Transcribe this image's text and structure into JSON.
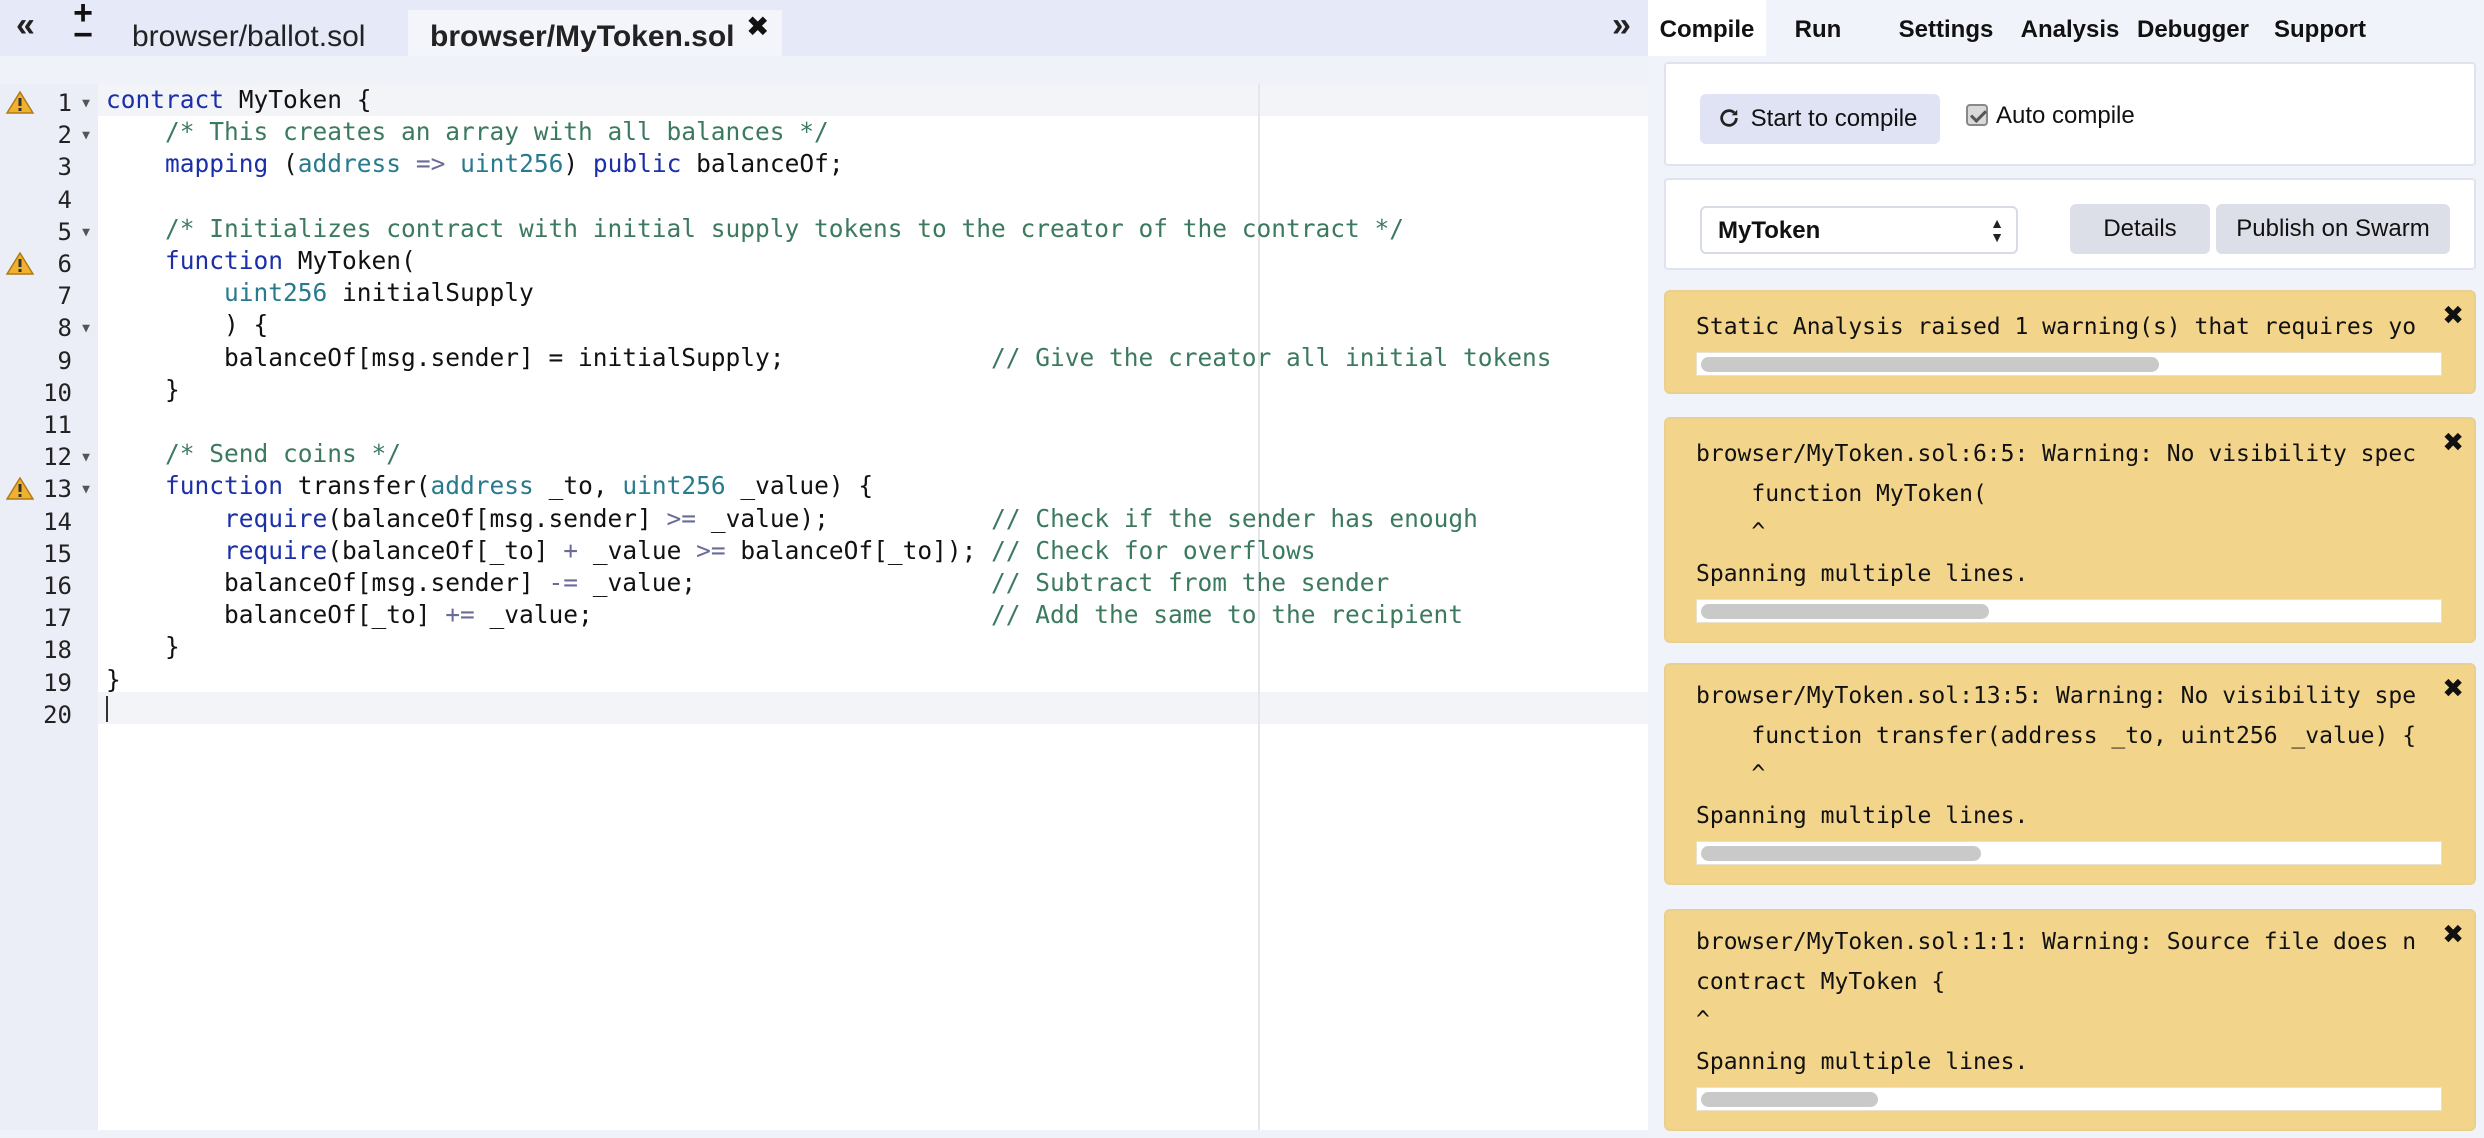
{
  "tabs": {
    "left_arrow": "«",
    "right_arrow": "»",
    "plus": "+",
    "minus": "−",
    "files": [
      "browser/ballot.sol",
      "browser/MyToken.sol"
    ],
    "close": "✖"
  },
  "editor": {
    "line_numbers": [
      "1",
      "2",
      "3",
      "4",
      "5",
      "6",
      "7",
      "8",
      "9",
      "10",
      "11",
      "12",
      "13",
      "14",
      "15",
      "16",
      "17",
      "18",
      "19",
      "20"
    ],
    "warning_lines": [
      1,
      6,
      13
    ],
    "fold_lines": [
      1,
      2,
      5,
      8,
      12,
      13
    ],
    "code": [
      "contract MyToken {",
      "    /* This creates an array with all balances */",
      "    mapping (address => uint256) public balanceOf;",
      "",
      "    /* Initializes contract with initial supply tokens to the creator of the contract */",
      "    function MyToken(",
      "        uint256 initialSupply",
      "        ) {",
      "        balanceOf[msg.sender] = initialSupply;              // Give the creator all initial tokens",
      "    }",
      "",
      "    /* Send coins */",
      "    function transfer(address _to, uint256 _value) {",
      "        require(balanceOf[msg.sender] >= _value);           // Check if the sender has enough",
      "        require(balanceOf[_to] + _value >= balanceOf[_to]); // Check for overflows",
      "        balanceOf[msg.sender] -= _value;                    // Subtract from the sender",
      "        balanceOf[_to] += _value;                           // Add the same to the recipient",
      "    }",
      "}",
      ""
    ]
  },
  "menu": {
    "compile": "Compile",
    "run": "Run",
    "settings": "Settings",
    "analysis": "Analysis",
    "debugger": "Debugger",
    "support": "Support"
  },
  "compile": {
    "start_label": "Start to compile",
    "auto_compile_label": "Auto compile",
    "auto_compile_checked": true
  },
  "contract": {
    "selected": "MyToken",
    "details_label": "Details",
    "publish_label": "Publish on Swarm"
  },
  "warnings": {
    "close": "✖",
    "static": {
      "text": "Static Analysis raised 1 warning(s) that requires yo",
      "scroll_fraction": 0.62
    },
    "w1": {
      "line1": "browser/MyToken.sol:6:5: Warning: No visibility spec",
      "line2": "    function MyToken(",
      "line3": "    ^",
      "line4": "Spanning multiple lines.",
      "scroll_fraction": 0.39
    },
    "w2": {
      "line1": "browser/MyToken.sol:13:5: Warning: No visibility spe",
      "line2": "    function transfer(address _to, uint256 _value) {",
      "line3": "    ^",
      "line4": "Spanning multiple lines.",
      "scroll_fraction": 0.38
    },
    "w3": {
      "line1": "browser/MyToken.sol:1:1: Warning: Source file does n",
      "line2": "contract MyToken {",
      "line3": "^",
      "line4": "Spanning multiple lines.",
      "scroll_fraction": 0.24
    }
  },
  "colors": {
    "keyword": "#1c2fa8",
    "type": "#287a8c",
    "comment": "#3c7a5f",
    "warning_bg": "#f2d48a"
  },
  "icons": [
    "warning-icon",
    "refresh-icon",
    "close-icon",
    "fold-arrow-icon",
    "double-chevron-icon"
  ]
}
